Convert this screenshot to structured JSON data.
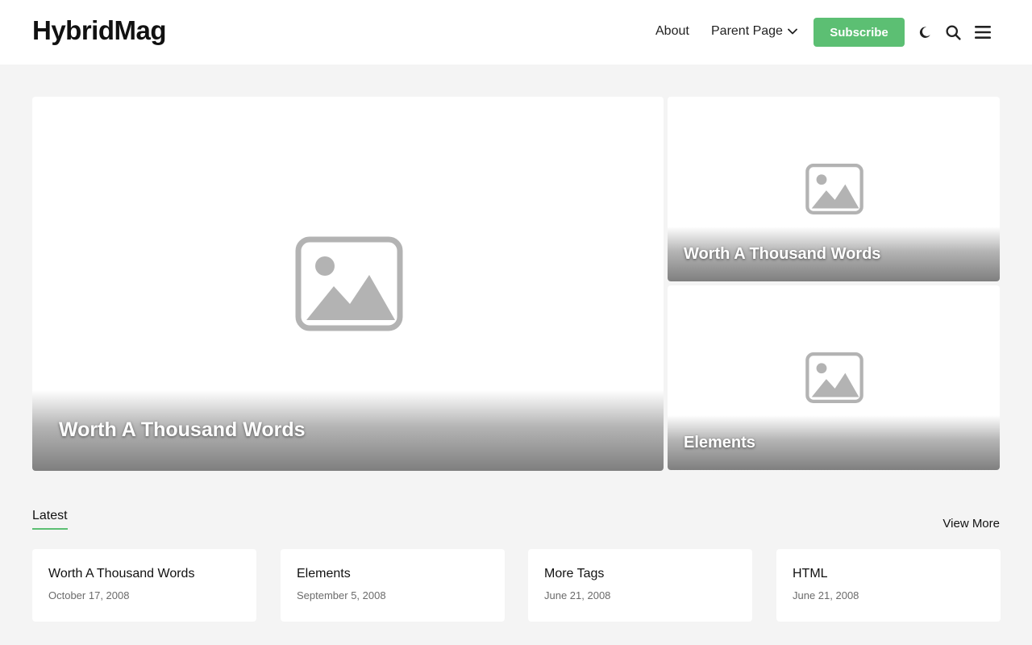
{
  "header": {
    "logo": "HybridMag",
    "nav": {
      "about": "About",
      "parent_page": "Parent Page"
    },
    "subscribe": "Subscribe",
    "icons": [
      "moon-icon",
      "search-icon",
      "menu-icon"
    ]
  },
  "featured": {
    "main": {
      "title": "Worth A Thousand Words"
    },
    "side": [
      {
        "title": "Worth A Thousand Words"
      },
      {
        "title": "Elements"
      }
    ]
  },
  "latest": {
    "heading": "Latest",
    "view_more": "View More",
    "posts": [
      {
        "title": "Worth A Thousand Words",
        "date": "October 17, 2008"
      },
      {
        "title": "Elements",
        "date": "September 5, 2008"
      },
      {
        "title": "More Tags",
        "date": "June 21, 2008"
      },
      {
        "title": "HTML",
        "date": "June 21, 2008"
      }
    ]
  },
  "colors": {
    "accent": "#5cbf73",
    "background": "#f4f4f4",
    "placeholder": "#b3b3b3"
  }
}
